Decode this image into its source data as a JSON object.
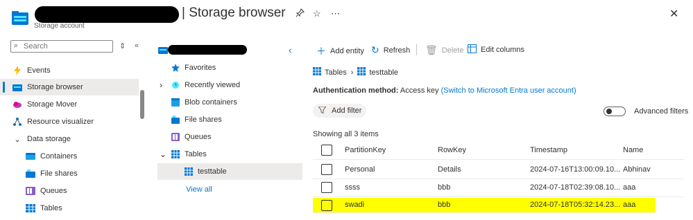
{
  "header": {
    "title": "| Storage browser",
    "subtitle": "Storage account",
    "icons": [
      "pin-icon",
      "star-icon",
      "more-icon",
      "close-icon"
    ],
    "redacted": true
  },
  "left_nav": {
    "search_placeholder": "Search",
    "items": [
      {
        "label": "Events",
        "icon": "lightning-icon",
        "active": false
      },
      {
        "label": "Storage browser",
        "icon": "storage-icon",
        "active": true
      },
      {
        "label": "Storage Mover",
        "icon": "cloud-icon",
        "active": false
      },
      {
        "label": "Resource visualizer",
        "icon": "graph-icon",
        "active": false
      },
      {
        "label": "Data storage",
        "icon": "chevron-down-icon",
        "active": false
      },
      {
        "label": "Containers",
        "icon": "container-icon",
        "active": false
      },
      {
        "label": "File shares",
        "icon": "fileshare-icon",
        "active": false
      },
      {
        "label": "Queues",
        "icon": "queue-icon",
        "active": false
      },
      {
        "label": "Tables",
        "icon": "table-icon",
        "active": false
      }
    ]
  },
  "tree": {
    "items": [
      {
        "label": "Favorites",
        "icon": "star-icon"
      },
      {
        "label": "Recently viewed",
        "icon": "clock-icon"
      },
      {
        "label": "Blob containers",
        "icon": "blob-icon"
      },
      {
        "label": "File shares",
        "icon": "fileshare-icon"
      },
      {
        "label": "Queues",
        "icon": "queue-icon"
      },
      {
        "label": "Tables",
        "icon": "table-icon"
      },
      {
        "label": "testtable",
        "icon": "table-icon"
      }
    ],
    "view_all": "View all"
  },
  "toolbar": {
    "add_entity": "Add entity",
    "refresh": "Refresh",
    "delete": "Delete",
    "edit_columns": "Edit columns"
  },
  "breadcrumb": {
    "root": "Tables",
    "current": "testtable"
  },
  "auth": {
    "label": "Authentication method:",
    "value": "Access key",
    "link": "(Switch to Microsoft Entra user account)"
  },
  "filter": {
    "add_filter": "Add filter",
    "advanced": "Advanced filters"
  },
  "table": {
    "count_text": "Showing all 3 items",
    "columns": [
      "PartitionKey",
      "RowKey",
      "Timestamp",
      "Name"
    ],
    "rows": [
      {
        "PartitionKey": "Personal",
        "RowKey": "Details",
        "Timestamp": "2024-07-16T13:00:09.10...",
        "Name": "Abhinav",
        "highlight": false
      },
      {
        "PartitionKey": "ssss",
        "RowKey": "bbb",
        "Timestamp": "2024-07-18T02:39:08.10...",
        "Name": "aaa",
        "highlight": false
      },
      {
        "PartitionKey": "swadi",
        "RowKey": "bbb",
        "Timestamp": "2024-07-18T05:32:14.23...",
        "Name": "aaa",
        "highlight": true
      }
    ]
  },
  "colors": {
    "accent": "#0078d4",
    "highlight": "#ffff00",
    "selected_bg": "#edebe9"
  }
}
